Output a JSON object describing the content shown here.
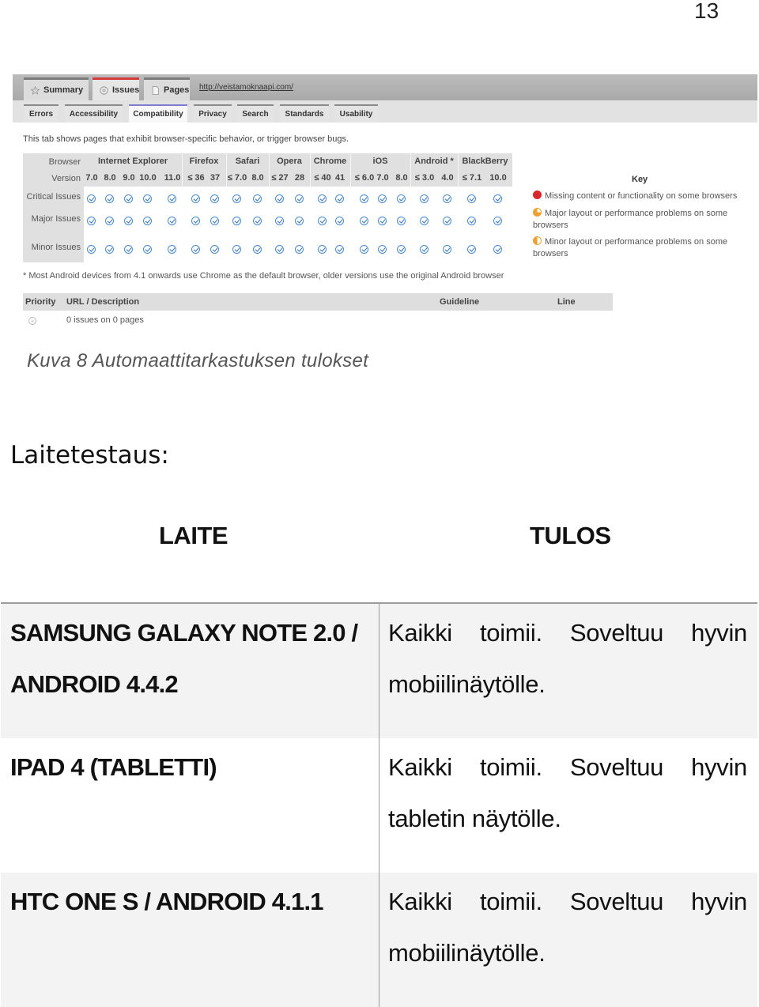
{
  "page_number": "13",
  "screenshot": {
    "main_tabs": [
      {
        "label": "Summary",
        "icon": "star-icon",
        "active": false
      },
      {
        "label": "Issues",
        "icon": "issues-icon",
        "active": true
      },
      {
        "label": "Pages",
        "icon": "page-icon",
        "active": false
      }
    ],
    "url": "http://veistamoknaapi.com/",
    "sub_tabs": [
      {
        "label": "Errors",
        "active": false
      },
      {
        "label": "Accessibility",
        "active": false
      },
      {
        "label": "Compatibility",
        "active": true
      },
      {
        "label": "Privacy",
        "active": false
      },
      {
        "label": "Search",
        "active": false
      },
      {
        "label": "Standards",
        "active": false
      },
      {
        "label": "Usability",
        "active": false
      }
    ],
    "intro": "This tab shows pages that exhibit browser-specific behavior, or trigger browser bugs.",
    "grid": {
      "browser_row_label": "Browser",
      "version_row_label": "Version",
      "row_labels": [
        "Critical Issues",
        "Major Issues",
        "Minor Issues"
      ],
      "groups": [
        {
          "name": "Internet Explorer",
          "versions": [
            "7.0",
            "8.0",
            "9.0",
            "10.0",
            "11.0"
          ]
        },
        {
          "name": "Firefox",
          "versions": [
            "≤ 36",
            "37"
          ]
        },
        {
          "name": "Safari",
          "versions": [
            "≤ 7.0",
            "8.0"
          ]
        },
        {
          "name": "Opera",
          "versions": [
            "≤ 27",
            "28"
          ]
        },
        {
          "name": "Chrome",
          "versions": [
            "≤ 40",
            "41"
          ]
        },
        {
          "name": "iOS",
          "versions": [
            "≤ 6.0",
            "7.0",
            "8.0"
          ]
        },
        {
          "name": "Android *",
          "versions": [
            "≤ 3.0",
            "4.0"
          ]
        },
        {
          "name": "BlackBerry",
          "versions": [
            "≤ 7.1",
            "10.0"
          ]
        }
      ],
      "cell_status": "pass",
      "cell_icon": "check-circle-icon"
    },
    "key": {
      "title": "Key",
      "items": [
        {
          "label": "Missing content or functionality on some browsers",
          "color": "#d9262a",
          "icon": "red-dot-icon"
        },
        {
          "label": "Major layout or performance problems on some browsers",
          "color": "#f0a030",
          "icon": "orange-three-quarter-icon"
        },
        {
          "label": "Minor layout or performance problems on some browsers",
          "color": "#f0a030",
          "icon": "orange-half-icon"
        }
      ]
    },
    "footnote": "* Most Android devices from 4.1 onwards use Chrome as the default browser, older versions use the original Android browser",
    "issues_table": {
      "headers": {
        "priority": "Priority",
        "url": "URL / Description",
        "guideline": "Guideline",
        "line": "Line"
      },
      "summary": "0 issues on 0 pages"
    }
  },
  "caption": "Kuva 8 Automaattitarkastuksen tulokset",
  "section_heading": "Laitetestaus:",
  "results_table": {
    "headers": {
      "device": "LAITE",
      "result": "TULOS"
    },
    "rows": [
      {
        "device": "SAMSUNG GALAXY NOTE 2.0 / ANDROID 4.4.2",
        "result": "Kaikki toimii. Soveltuu hyvin mobiilinäytölle."
      },
      {
        "device": "IPAD 4 (TABLETTI)",
        "result": "Kaikki toimii. Soveltuu hyvin tabletin näytölle."
      },
      {
        "device": "HTC ONE S / ANDROID 4.1.1",
        "result": "Kaikki toimii. Soveltuu hyvin mobiilinäytölle."
      }
    ]
  }
}
